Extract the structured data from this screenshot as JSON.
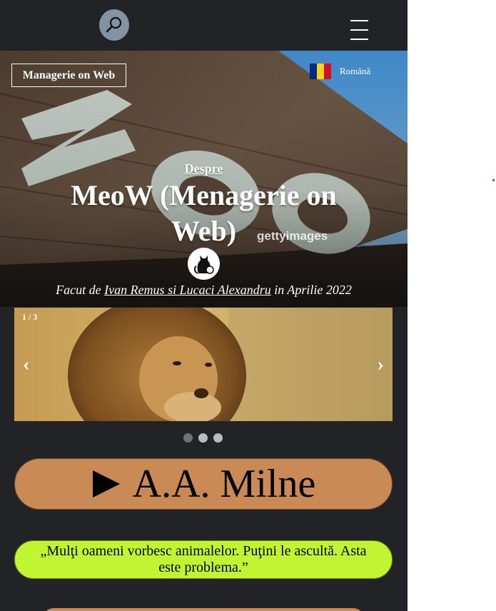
{
  "header": {
    "search_icon": "search-icon",
    "menu_icon": "hamburger-menu-icon"
  },
  "hero": {
    "brand": "Managerie on Web",
    "language": {
      "label": "Română",
      "flag_colors": [
        "#002B7F",
        "#FCD116",
        "#CE1126"
      ]
    },
    "about_link": "Despre",
    "title": "MeoW (Menagerie on Web)",
    "watermark": "gettyimages",
    "credit_prefix": "Facut de",
    "credit_authors": "Ivan Remus si Lucaci Alexandru",
    "credit_suffix": "in Aprilie 2022"
  },
  "carousel": {
    "counter": "1 / 3",
    "prev": "‹",
    "next": "›",
    "total_slides": 3,
    "active_slide": 1
  },
  "audio_button": {
    "icon": "play-icon",
    "label": "A.A. Milne",
    "color": "#c98a55"
  },
  "quote": {
    "text": "„Mulţi oameni vorbesc animalelor. Puţini le ascultă. Asta este problema.”",
    "color": "#c2f531"
  }
}
